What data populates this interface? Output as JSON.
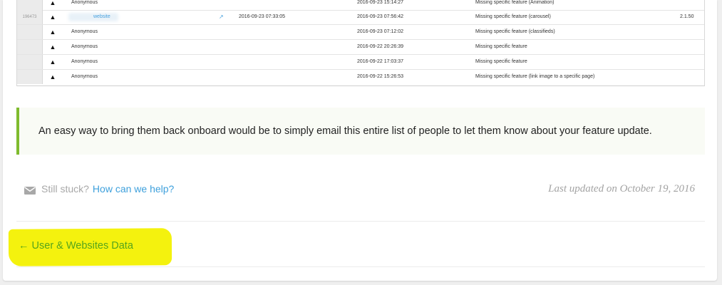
{
  "table": {
    "rows": [
      {
        "id": "",
        "icon": "warning-icon",
        "user": "Anonymous",
        "user_is_link": false,
        "external": false,
        "date1": "",
        "date2": "2016-09-23 15:14:27",
        "reason": "Missing specific feature (Animation)",
        "version": ""
      },
      {
        "id": "196473",
        "icon": "warning-icon",
        "user": "website",
        "user_is_link": true,
        "external": true,
        "date1": "2016-09-23 07:33:05",
        "date2": "2016-09-23 07:56:42",
        "reason": "Missing specific feature (carousel)",
        "version": "2.1.50"
      },
      {
        "id": "",
        "icon": "warning-icon",
        "user": "Anonymous",
        "user_is_link": false,
        "external": false,
        "date1": "",
        "date2": "2016-09-23 07:12:02",
        "reason": "Missing specific feature (classifieds)",
        "version": ""
      },
      {
        "id": "",
        "icon": "warning-icon",
        "user": "Anonymous",
        "user_is_link": false,
        "external": false,
        "date1": "",
        "date2": "2016-09-22 20:26:39",
        "reason": "Missing specific feature",
        "version": ""
      },
      {
        "id": "",
        "icon": "warning-icon",
        "user": "Anonymous",
        "user_is_link": false,
        "external": false,
        "date1": "",
        "date2": "2016-09-22 17:03:37",
        "reason": "Missing specific feature",
        "version": ""
      },
      {
        "id": "",
        "icon": "warning-icon",
        "user": "Anonymous",
        "user_is_link": false,
        "external": false,
        "date1": "",
        "date2": "2016-09-22 15:26:53",
        "reason": "Missing specific feature (link image to a specific page)",
        "version": ""
      }
    ]
  },
  "callout": {
    "text": "An easy way to bring them back onboard would be to simply email this entire list of people to let them know about your feature update.",
    "accent_color": "#7fbb2e"
  },
  "help": {
    "icon": "envelope-icon",
    "muted": "Still stuck?",
    "link": "How can we help?"
  },
  "updated": "Last updated on October 19, 2016",
  "nav": {
    "prev_label": "← User & Websites Data",
    "highlight_color": "#f4f20e"
  }
}
